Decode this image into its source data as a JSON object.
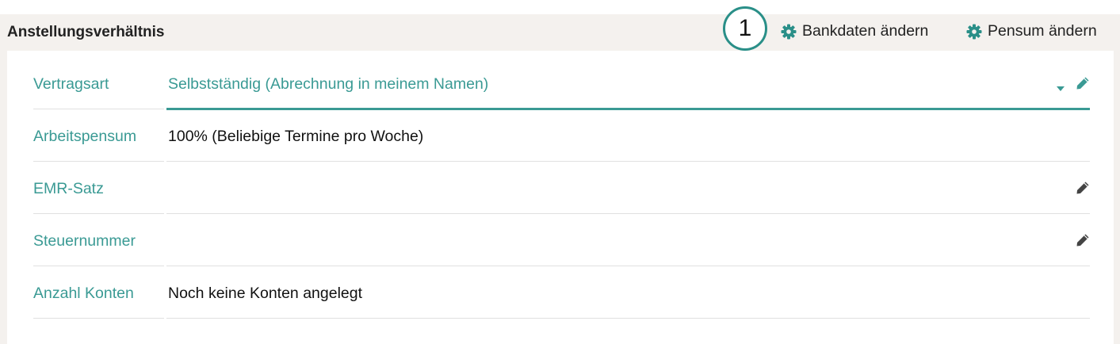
{
  "header": {
    "title": "Anstellungsverhältnis",
    "callout_number": "1",
    "actions": [
      {
        "label": "Bankdaten ändern",
        "icon": "gear-icon"
      },
      {
        "label": "Pensum ändern",
        "icon": "gear-icon"
      }
    ]
  },
  "fields": [
    {
      "label": "Vertragsart",
      "value": "Selbstständig (Abrechnung in meinem Namen)",
      "editable": true,
      "dropdown": true
    },
    {
      "label": "Arbeitspensum",
      "value": "100% (Beliebige Termine pro Woche)",
      "editable": false
    },
    {
      "label": "EMR-Satz",
      "value": "",
      "editable": true
    },
    {
      "label": "Steuernummer",
      "value": "",
      "editable": true
    },
    {
      "label": "Anzahl Konten",
      "value": "Noch keine Konten angelegt",
      "editable": false
    }
  ],
  "colors": {
    "accent": "#3a9a94",
    "gear": "#2a8f88",
    "header_bg": "#f4f1ee"
  }
}
